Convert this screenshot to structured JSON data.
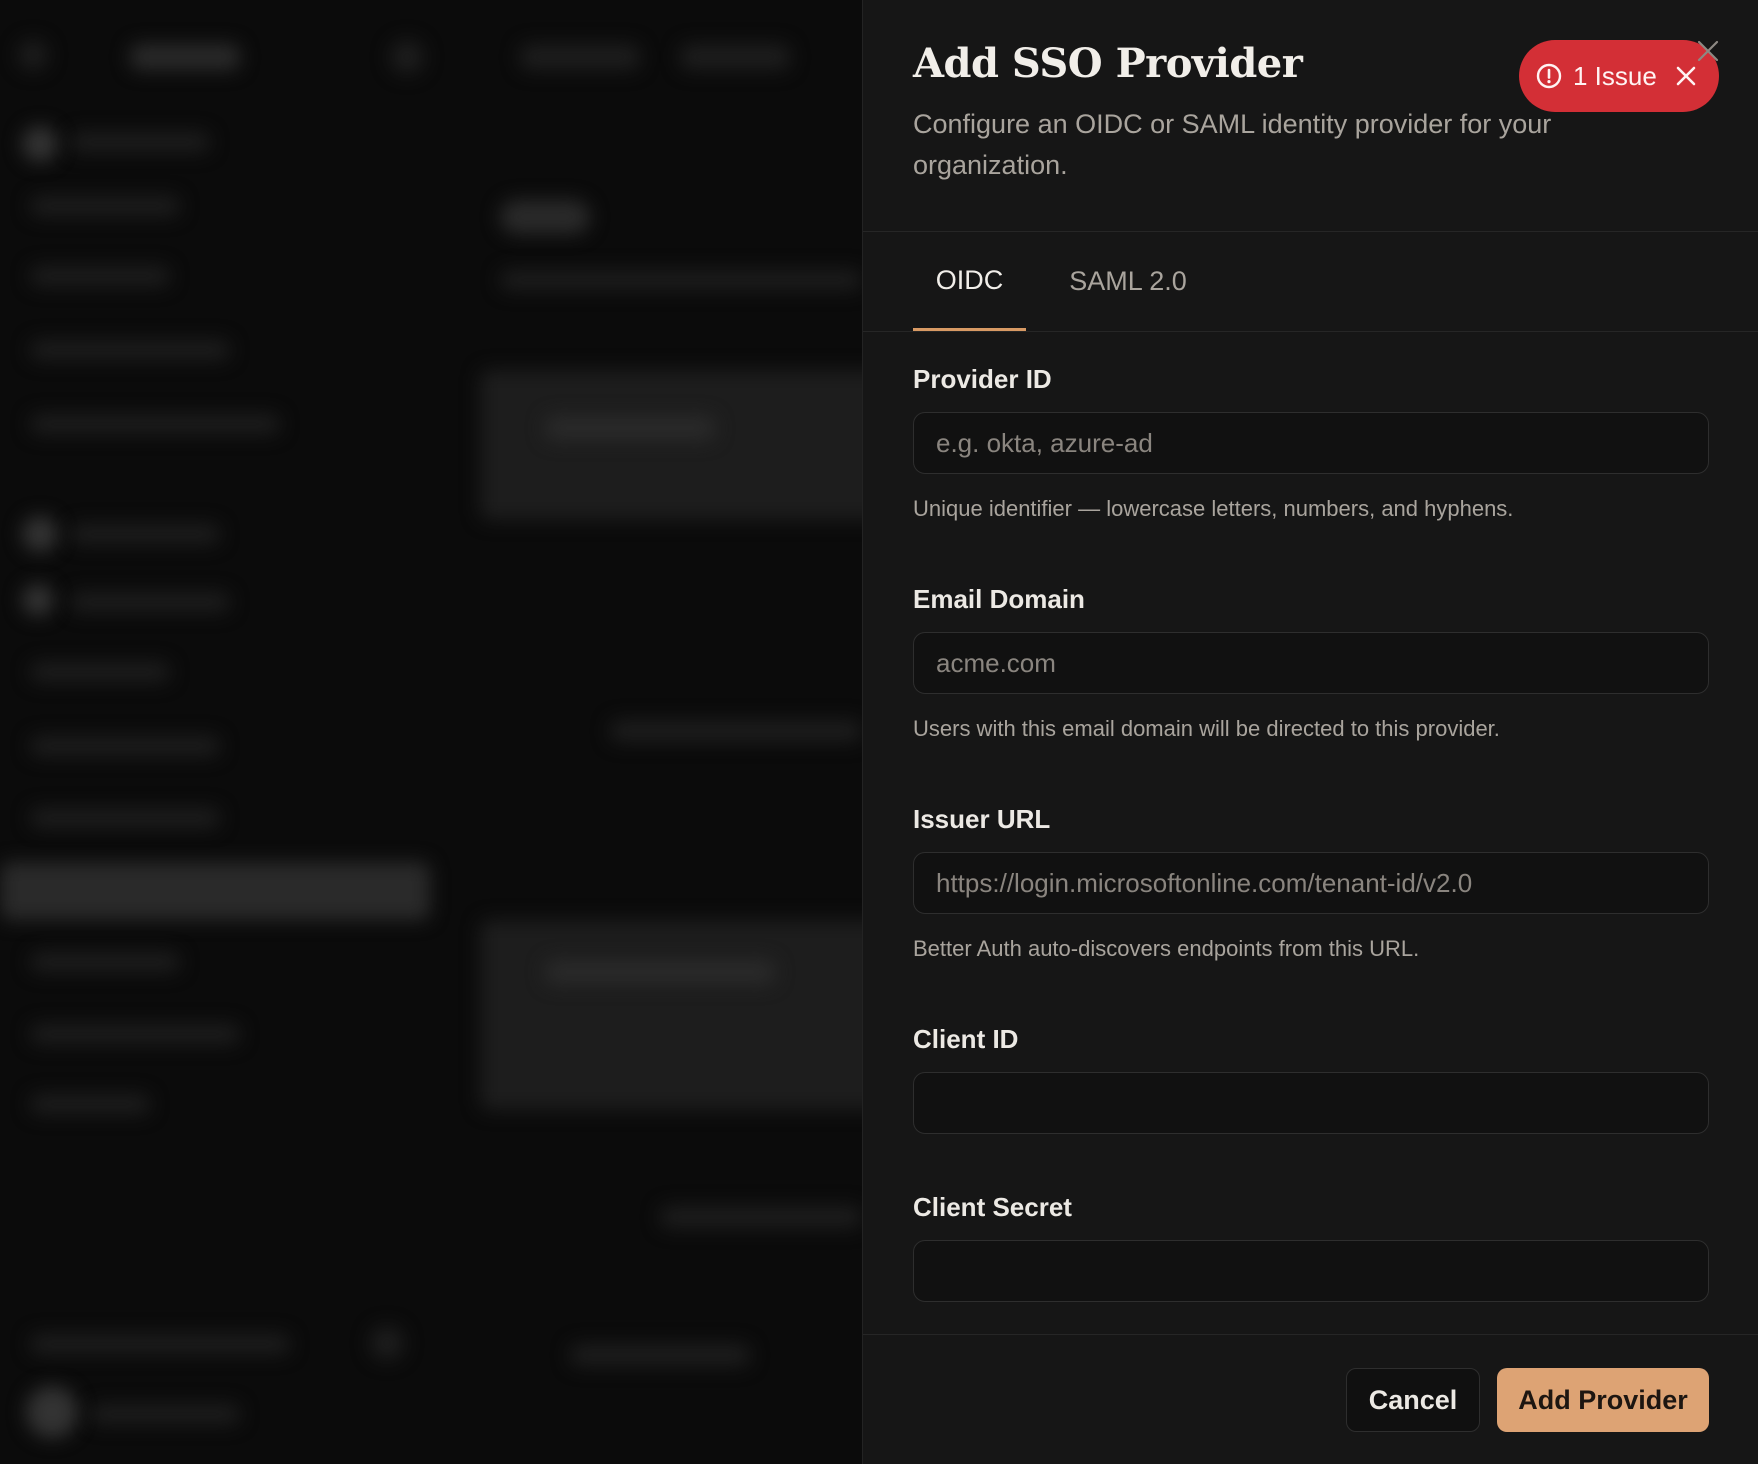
{
  "sheet": {
    "title": "Add SSO Provider",
    "subtitle": "Configure an OIDC or SAML identity provider for your organization."
  },
  "issue_badge": {
    "label": "1 Issue",
    "color": "#d32f36"
  },
  "tabs": [
    {
      "label": "OIDC",
      "active": true
    },
    {
      "label": "SAML 2.0",
      "active": false
    }
  ],
  "fields": {
    "provider_id": {
      "label": "Provider ID",
      "placeholder": "e.g. okta, azure-ad",
      "help": "Unique identifier — lowercase letters, numbers, and hyphens."
    },
    "email_domain": {
      "label": "Email Domain",
      "placeholder": "acme.com",
      "help": "Users with this email domain will be directed to this provider."
    },
    "issuer_url": {
      "label": "Issuer URL",
      "placeholder": "https://login.microsoftonline.com/tenant-id/v2.0",
      "help": "Better Auth auto-discovers endpoints from this URL."
    },
    "client_id": {
      "label": "Client ID",
      "placeholder": ""
    },
    "client_secret": {
      "label": "Client Secret",
      "placeholder": ""
    }
  },
  "footer": {
    "cancel_label": "Cancel",
    "submit_label": "Add Provider"
  },
  "colors": {
    "accent": "#dda374",
    "danger": "#d32f36",
    "panel": "#161616",
    "input_bg": "#111111"
  },
  "icons": {
    "close": "close-icon",
    "issue": "alert-circle-icon",
    "dismiss_issue": "close-icon"
  }
}
